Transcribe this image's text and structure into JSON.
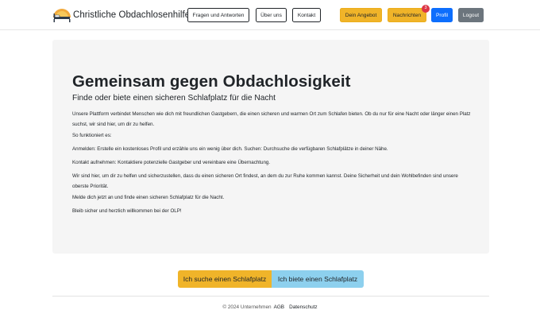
{
  "navbar": {
    "brand": "Christliche Obdachlosenhilfe",
    "logo_icon": "sunset-bed-logo",
    "links": {
      "faq": "Fragen und Antworten",
      "about": "Über uns",
      "contact": "Kontakt"
    },
    "buttons": {
      "offer": "Dein Angebot",
      "messages": "Nachrichten",
      "messages_badge": "3",
      "profile": "Profil",
      "logout": "Logout"
    }
  },
  "hero": {
    "title": "Gemeinsam gegen Obdachlosigkeit",
    "subtitle": "Finde oder biete einen sicheren Schlafplatz für die Nacht",
    "paragraphs": [
      "Unsere Plattform verbindet Menschen wie dich mit freundlichen Gastgebern, die einen sicheren und warmen Ort zum Schlafen bieten. Ob du nur für eine Nacht oder länger einen Platz suchst, wir sind hier, um dir zu helfen.",
      "So funktioniert es:",
      "Anmelden: Erstelle ein kostenloses Profil und erzähle uns ein wenig über dich. Suchen: Durchsuche die verfügbaren Schlafplätze in deiner Nähe.",
      "Kontakt aufnehmen: Kontaktiere potenzielle Gastgeber und vereinbare eine Übernachtung.",
      "Wir sind hier, um dir zu helfen und sicherzustellen, dass du einen sicheren Ort findest, an dem du zur Ruhe kommen kannst. Deine Sicherheit und dein Wohlbefinden sind unsere oberste Priorität.",
      "Melde dich jetzt an und finde einen sicheren Schlafplatz für die Nacht.",
      "Bleib sicher und herzlich willkommen bei der OLP!"
    ]
  },
  "cta": {
    "search": "Ich suche einen Schlafplatz",
    "offer": "Ich biete einen Schlafplatz"
  },
  "footer": {
    "copyright": "© 2024 Unternehmen",
    "agb": "AGB",
    "privacy": "Datenschutz"
  },
  "colors": {
    "warning": "#f0b429",
    "primary": "#0d6efd",
    "secondary": "#6c757d",
    "info": "#8dd0ee",
    "badge": "#dc3545",
    "jumbotron_bg": "#f5f5f5"
  }
}
